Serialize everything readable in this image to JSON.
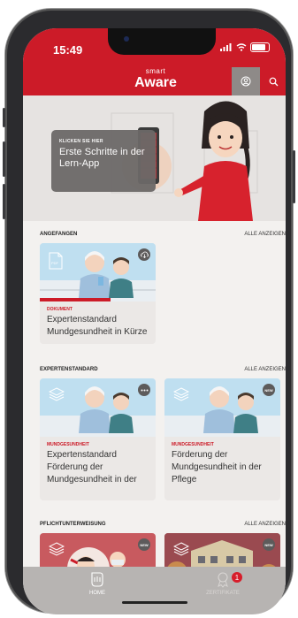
{
  "status": {
    "time": "15:49"
  },
  "header": {
    "logo_small": "smart",
    "logo_big": "Aware",
    "user_icon": "user-circle-icon",
    "search_icon": "search-icon",
    "accent": "#cc1b28"
  },
  "hero": {
    "kicker": "KLICKEN SIE HIER",
    "title": "Erste Schritte in der Lern-App"
  },
  "sections": {
    "s1": {
      "title": "ANGEFANGEN",
      "all": "ALLE ANZEIGEN"
    },
    "s2": {
      "title": "EXPERTENSTANDARD",
      "all": "ALLE ANZEIGEN"
    },
    "s3": {
      "title": "PFLICHTUNTERWEISUNG",
      "all": "ALLE ANZEIGEN"
    }
  },
  "cards": {
    "c1": {
      "category": "DOKUMENT",
      "title": "Expertenstandard Mundgesundheit in Kürze",
      "doc_label": "PDF"
    },
    "c2": {
      "category": "MUNDGESUNDHEIT",
      "title": "Expertenstandard Förderung der Mundgesundheit in der"
    },
    "c3": {
      "category": "MUNDGESUNDHEIT",
      "title": "Förderung der Mundgesundheit in der Pflege",
      "badge": "NEW"
    },
    "c4": {
      "badge": "NEW"
    },
    "c5": {
      "badge": "NEW"
    }
  },
  "tabs": {
    "home": "HOME",
    "zertifikate": "ZERTIFIKATE",
    "badge_count": "1"
  }
}
